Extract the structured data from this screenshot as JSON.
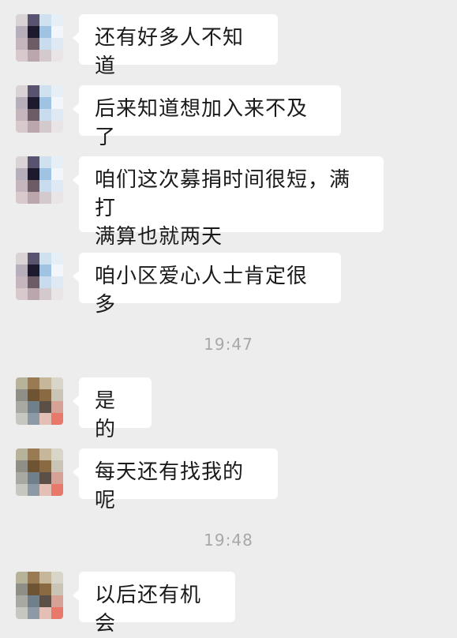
{
  "colors": {
    "background": "#ededed",
    "bubble": "#ffffff",
    "text": "#1a1a1a",
    "timestamp": "#a8a8a8"
  },
  "messages": [
    {
      "text": "还有好多人不知道",
      "avatar": "avatar-a"
    },
    {
      "text": "后来知道想加入来不及了",
      "avatar": "avatar-a"
    },
    {
      "text": "咱们这次募捐时间很短，满打\n满算也就两天",
      "avatar": "avatar-a"
    },
    {
      "text": "咱小区爱心人士肯定很多",
      "avatar": "avatar-a"
    },
    {
      "timestamp": "19:47"
    },
    {
      "text": "是的",
      "avatar": "avatar-b"
    },
    {
      "text": "每天还有找我的呢",
      "avatar": "avatar-b"
    },
    {
      "timestamp": "19:48"
    },
    {
      "text": "以后还有机会",
      "avatar": "avatar-b"
    }
  ]
}
